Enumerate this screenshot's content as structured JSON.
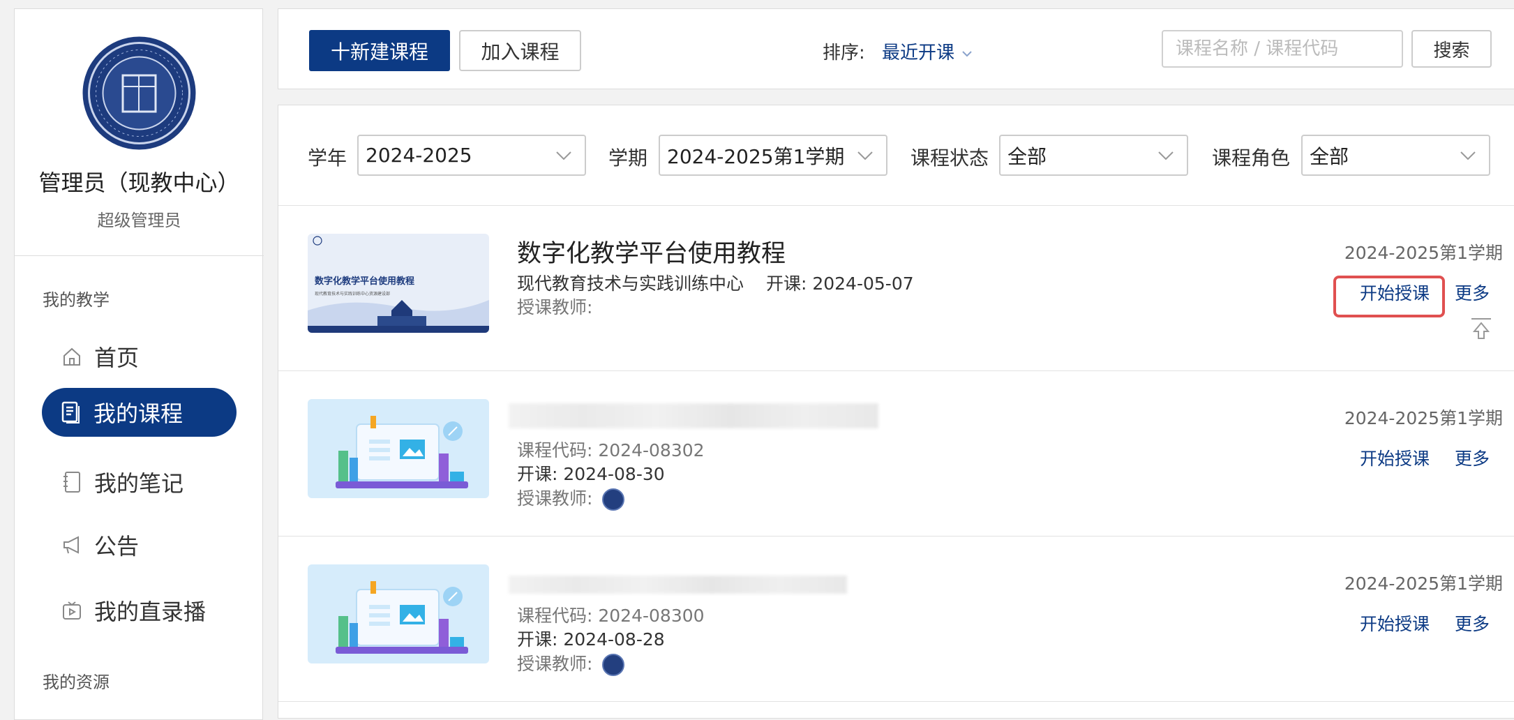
{
  "sidebar": {
    "user_name": "管理员（现教中心）",
    "user_role": "超级管理员",
    "section_teaching": "我的教学",
    "items": [
      {
        "label": "首页",
        "icon": "home-icon"
      },
      {
        "label": "我的课程",
        "icon": "document-icon",
        "active": true
      },
      {
        "label": "我的笔记",
        "icon": "notebook-icon"
      },
      {
        "label": "公告",
        "icon": "megaphone-icon"
      },
      {
        "label": "我的直录播",
        "icon": "video-icon"
      }
    ],
    "section_resources": "我的资源"
  },
  "toolbar": {
    "new_course": "十新建课程",
    "join_course": "加入课程",
    "sort_label": "排序:",
    "sort_value": "最近开课",
    "search_placeholder": "课程名称 / 课程代码",
    "search_button": "搜索"
  },
  "filters": {
    "year_label": "学年",
    "year_value": "2024-2025",
    "term_label": "学期",
    "term_value": "2024-2025第1学期",
    "status_label": "课程状态",
    "status_value": "全部",
    "role_label": "课程角色",
    "role_value": "全部"
  },
  "courses": [
    {
      "title": "数字化教学平台使用教程",
      "org": "现代教育技术与实践训练中心",
      "start": "开课: 2024-05-07",
      "teacher": "授课教师:",
      "semester": "2024-2025第1学期",
      "start_teaching": "开始授课",
      "more": "更多",
      "thumb_title": "数字化教学平台使用教程",
      "thumb_sub": "现代教育技术与实践训练中心资源建设部"
    },
    {
      "code": "课程代码: 2024-08302",
      "start": "开课: 2024-08-30",
      "teacher": "授课教师:",
      "semester": "2024-2025第1学期",
      "start_teaching": "开始授课",
      "more": "更多"
    },
    {
      "code": "课程代码: 2024-08300",
      "start": "开课: 2024-08-28",
      "teacher": "授课教师:",
      "semester": "2024-2025第1学期",
      "start_teaching": "开始授课",
      "more": "更多"
    }
  ],
  "colors": {
    "primary": "#0c3a84",
    "highlight": "#e05050"
  }
}
